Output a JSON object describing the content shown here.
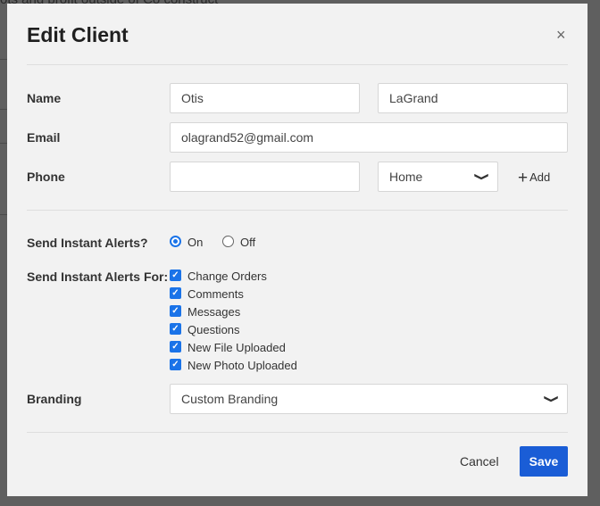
{
  "background": {
    "text": "ots and profit outside of Co construct"
  },
  "modal": {
    "title": "Edit Client",
    "close_icon": "×",
    "name_label": "Name",
    "first_name": "Otis",
    "last_name": "LaGrand",
    "email_label": "Email",
    "email": "olagrand52@gmail.com",
    "phone_label": "Phone",
    "phone": "",
    "phone_type": "Home",
    "add_label": "Add",
    "alerts_label": "Send Instant Alerts?",
    "alerts_options": [
      "On",
      "Off"
    ],
    "alerts_selected": "On",
    "alerts_for_label": "Send Instant Alerts For:",
    "alerts_for": [
      {
        "label": "Change Orders",
        "checked": true
      },
      {
        "label": "Comments",
        "checked": true
      },
      {
        "label": "Messages",
        "checked": true
      },
      {
        "label": "Questions",
        "checked": true
      },
      {
        "label": "New File Uploaded",
        "checked": true
      },
      {
        "label": "New Photo Uploaded",
        "checked": true
      }
    ],
    "branding_label": "Branding",
    "branding": "Custom Branding",
    "cancel_label": "Cancel",
    "save_label": "Save",
    "accent_color": "#1a5dd6"
  }
}
